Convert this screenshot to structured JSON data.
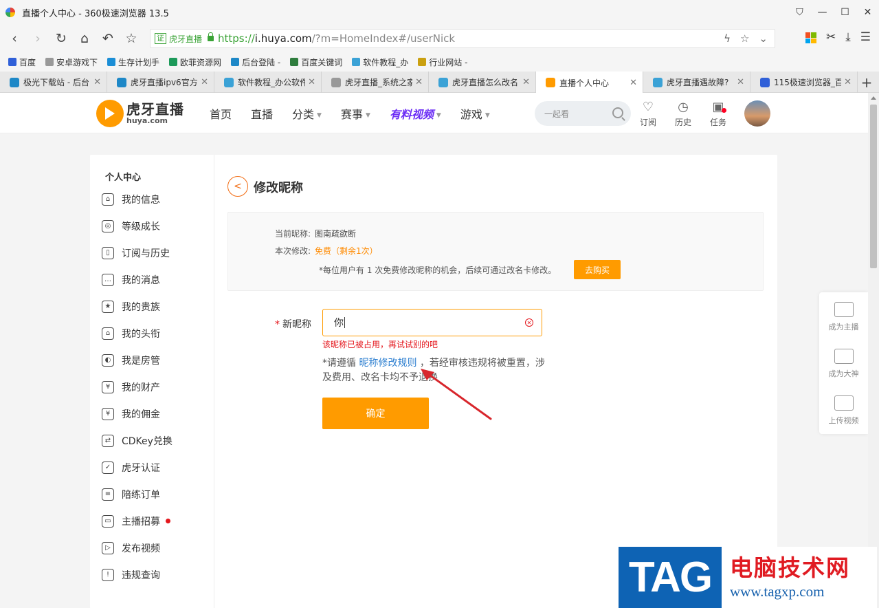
{
  "window": {
    "title": "直播个人中心 - 360极速浏览器 13.5",
    "controls": [
      "shirt-icon",
      "minimize-icon",
      "maximize-icon",
      "close-icon"
    ]
  },
  "addressbar": {
    "cert_label": "证",
    "cert_name": "虎牙直播",
    "url_proto": "https://",
    "url_host": "i.huya.com",
    "url_path": "/?m=HomeIndex#/userNick"
  },
  "bookmarks": [
    {
      "label": "百度",
      "color": "#3060d8"
    },
    {
      "label": "安卓游戏下",
      "color": "#999999"
    },
    {
      "label": "生存计划手",
      "color": "#1b8ed6"
    },
    {
      "label": "欧菲资源网",
      "color": "#1d9a5a"
    },
    {
      "label": "后台登陆 -",
      "color": "#1e88c7"
    },
    {
      "label": "百度关键词",
      "color": "#2f7d3e"
    },
    {
      "label": "软件教程_办",
      "color": "#3ba2d6"
    },
    {
      "label": "行业网站 -",
      "color": "#caa010"
    }
  ],
  "tabs": [
    {
      "label": "极光下载站 - 后台",
      "color": "#1e88c7",
      "active": false
    },
    {
      "label": "虎牙直播ipv6官方",
      "color": "#1e88c7",
      "active": false
    },
    {
      "label": "软件教程_办公软件",
      "color": "#3ba2d6",
      "active": false
    },
    {
      "label": "虎牙直播_系统之家",
      "color": "#999999",
      "active": false
    },
    {
      "label": "虎牙直播怎么改名",
      "color": "#3ba2d6",
      "active": false
    },
    {
      "label": "直播个人中心",
      "color": "#ff9b00",
      "active": true
    },
    {
      "label": "虎牙直播遇故障?",
      "color": "#3ba2d6",
      "active": false
    },
    {
      "label": "115极速浏览器_百",
      "color": "#3060d8",
      "active": false
    }
  ],
  "site": {
    "brand_name": "虎牙直播",
    "brand_url": "huya.com",
    "nav": [
      {
        "label": "首页",
        "caret": false,
        "highlight": false
      },
      {
        "label": "直播",
        "caret": false,
        "highlight": false
      },
      {
        "label": "分类",
        "caret": true,
        "highlight": false
      },
      {
        "label": "赛事",
        "caret": true,
        "highlight": false
      },
      {
        "label": "有料视频",
        "caret": true,
        "highlight": true
      },
      {
        "label": "游戏",
        "caret": true,
        "highlight": false
      }
    ],
    "search_placeholder": "一起看",
    "header_icons": [
      {
        "label": "订阅",
        "glyph": "♡",
        "dot": false
      },
      {
        "label": "历史",
        "glyph": "◷",
        "dot": false
      },
      {
        "label": "任务",
        "glyph": "▣",
        "dot": true
      }
    ]
  },
  "sidebar": {
    "heading": "个人中心",
    "items": [
      {
        "label": "我的信息",
        "icon": "⌂",
        "dot": false
      },
      {
        "label": "等级成长",
        "icon": "◎",
        "dot": false
      },
      {
        "label": "订阅与历史",
        "icon": "▯",
        "dot": false
      },
      {
        "label": "我的消息",
        "icon": "…",
        "dot": false
      },
      {
        "label": "我的贵族",
        "icon": "★",
        "dot": false
      },
      {
        "label": "我的头衔",
        "icon": "⌂",
        "dot": false
      },
      {
        "label": "我是房管",
        "icon": "◐",
        "dot": false
      },
      {
        "label": "我的财产",
        "icon": "¥",
        "dot": false
      },
      {
        "label": "我的佣金",
        "icon": "¥",
        "dot": false
      },
      {
        "label": "CDKey兑换",
        "icon": "⇄",
        "dot": false
      },
      {
        "label": "虎牙认证",
        "icon": "✓",
        "dot": false
      },
      {
        "label": "陪练订单",
        "icon": "≡",
        "dot": false
      },
      {
        "label": "主播招募",
        "icon": "▭",
        "dot": true
      },
      {
        "label": "发布视频",
        "icon": "▷",
        "dot": false
      },
      {
        "label": "违规查询",
        "icon": "!",
        "dot": false
      }
    ]
  },
  "form": {
    "back_glyph": "<",
    "title": "修改昵称",
    "current_label": "当前昵称:",
    "current_value": "图南疏欲断",
    "cost_label": "本次修改:",
    "cost_value": "免费（剩余1次）",
    "note": "*每位用户有 1 次免费修改昵称的机会，后续可通过改名卡修改。",
    "buy_label": "去购买",
    "required_mark": "*",
    "new_label": "新昵称",
    "new_value": "你",
    "error": "该昵称已被占用，再试试别的吧",
    "rule_prefix": "*请遵循 ",
    "rule_link": "昵称修改规则",
    "rule_suffix": " ，若经审核违规将被重置，涉及费用、改名卡均不予退换",
    "submit_label": "确定"
  },
  "floatbar": [
    {
      "label": "成为主播"
    },
    {
      "label": "成为大神"
    },
    {
      "label": "上传视频"
    }
  ],
  "watermark": {
    "tag": "TAG",
    "cn": "电脑技术网",
    "url": "www.tagxp.com"
  },
  "colors": {
    "accent": "#ff9b00",
    "error": "#e4161c",
    "link": "#2d7fd0",
    "secure": "#3aa336",
    "highlight_nav": "#6b2cf5"
  }
}
